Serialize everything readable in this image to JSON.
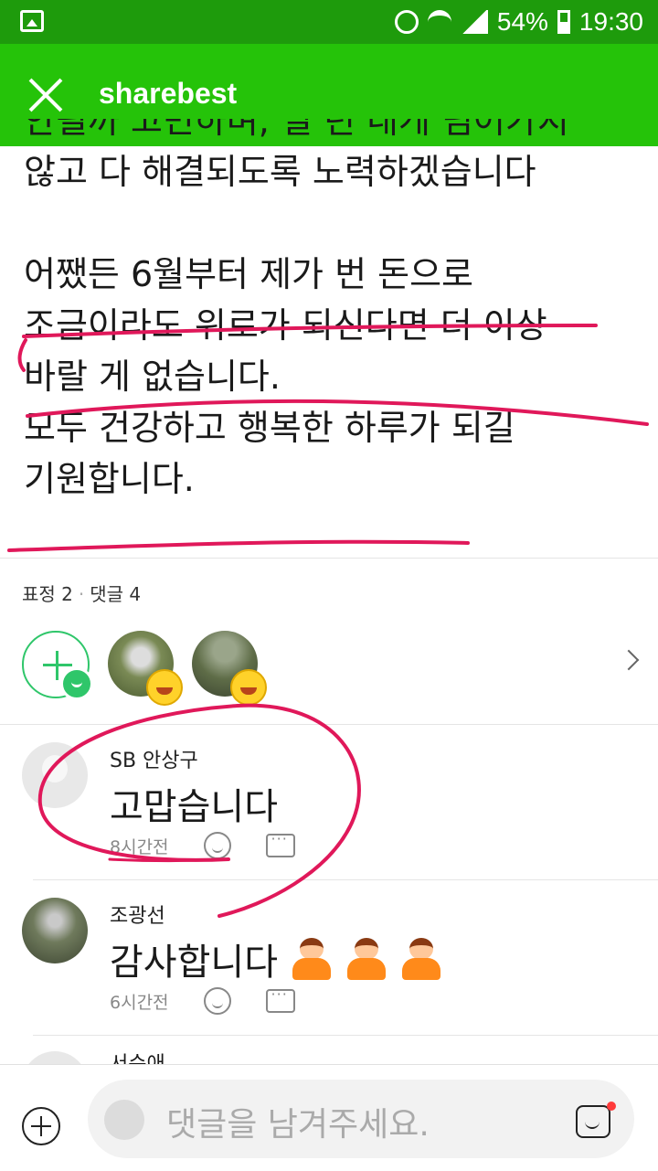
{
  "status_bar": {
    "battery": "54%",
    "time": "19:30"
  },
  "app_bar": {
    "title": "sharebest"
  },
  "post": {
    "cut_line": "안될까 고민하며, 일 년 내게 넘어가지",
    "lines": [
      "않고 다 해결되도록 노력하겠습니다",
      "",
      "어쨌든 6월부터 제가 번 돈으로",
      "조금이라도 위로가 되신다면 더 이상",
      "바랄 게 없습니다.",
      "모두 건강하고 행복한 하루가 되길",
      "기원합니다."
    ]
  },
  "stats": {
    "reactions": "표정 2",
    "comments": "댓글 4"
  },
  "comments": [
    {
      "name": "SB 안상구",
      "text": "고맙습니다",
      "time": "8시간전"
    },
    {
      "name": "조광선",
      "text": "감사합니다",
      "time": "6시간전"
    },
    {
      "name": "서순애"
    }
  ],
  "input": {
    "placeholder": "댓글을 남겨주세요."
  },
  "colors": {
    "status_bar": "#1e9b0c",
    "app_bar": "#25c309",
    "accent": "#2fc66a",
    "annotation": "#e0185a"
  }
}
